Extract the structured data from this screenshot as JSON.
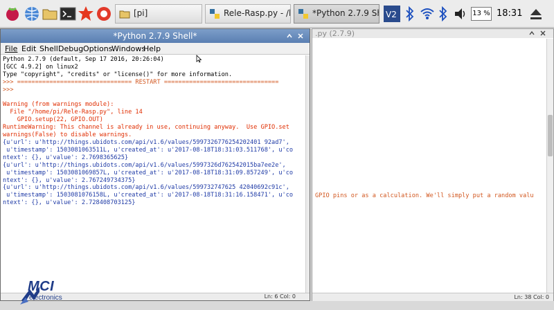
{
  "taskbar": {
    "icons": [
      "raspberry-menu-icon",
      "web-browser-icon",
      "file-manager-icon",
      "terminal-icon",
      "wolfram-icon",
      "mathematica-icon"
    ],
    "tasks": [
      {
        "label": "[pi]"
      },
      {
        "label": "Rele-Rasp.py - /ho..."
      },
      {
        "label": "*Python 2.7.9 Shell*"
      }
    ],
    "cpu": "13 %",
    "clock": "18:31"
  },
  "shell": {
    "title": "*Python 2.7.9 Shell*",
    "menu": [
      "File",
      "Edit",
      "Shell",
      "Debug",
      "Options",
      "Windows",
      "Help"
    ],
    "lines": [
      {
        "text": "Python 2.7.9 (default, Sep 17 2016, 20:26:04)",
        "style": "black"
      },
      {
        "text": "[GCC 4.9.2] on linux2",
        "style": "black"
      },
      {
        "text": "Type \"copyright\", \"credits\" or \"license()\" for more information.",
        "style": "black"
      },
      {
        "text": ">>> ================================ RESTART ================================",
        "style": "brown"
      },
      {
        "text": ">>>",
        "style": "brown"
      },
      {
        "text": "",
        "style": "black"
      },
      {
        "text": "Warning (from warnings module):",
        "style": "red"
      },
      {
        "text": "  File \"/home/pi/Rele-Rasp.py\", line 14",
        "style": "red"
      },
      {
        "text": "    GPIO.setup(22, GPIO.OUT)",
        "style": "red"
      },
      {
        "text": "RuntimeWarning: This channel is already in use, continuing anyway.  Use GPIO.set",
        "style": "red"
      },
      {
        "text": "warnings(False) to disable warnings.",
        "style": "red"
      },
      {
        "text": "{u'url': u'http://things.ubidots.com/api/v1.6/values/5997326776254202401 92ad7',",
        "style": "blue"
      },
      {
        "text": " u'timestamp': 1503081063511L, u'created_at': u'2017-08-18T18:31:03.511768', u'co",
        "style": "blue"
      },
      {
        "text": "ntext': {}, u'value': 2.7698365625}",
        "style": "blue"
      },
      {
        "text": "{u'url': u'http://things.ubidots.com/api/v1.6/values/5997326d762542015ba7ee2e',",
        "style": "blue"
      },
      {
        "text": " u'timestamp': 1503081069857L, u'created_at': u'2017-08-18T18:31:09.857249', u'co",
        "style": "blue"
      },
      {
        "text": "ntext': {}, u'value': 2.767249734375}",
        "style": "blue"
      },
      {
        "text": "{u'url': u'http://things.ubidots.com/api/v1.6/values/599732747625 42040692c91c',",
        "style": "blue"
      },
      {
        "text": " u'timestamp': 1503081076158L, u'created_at': u'2017-08-18T18:31:16.158471', u'co",
        "style": "blue"
      },
      {
        "text": "ntext': {}, u'value': 2.728408703125}",
        "style": "blue"
      }
    ],
    "status": "Ln: 6 Col: 0"
  },
  "editor": {
    "title": ".py (2.7.9)",
    "text": "GPIO pins or as a calculation. We'll simply put a random valu",
    "status": "Ln: 38 Col: 0"
  },
  "logo": {
    "name": "MCI",
    "sub": "electronics"
  }
}
